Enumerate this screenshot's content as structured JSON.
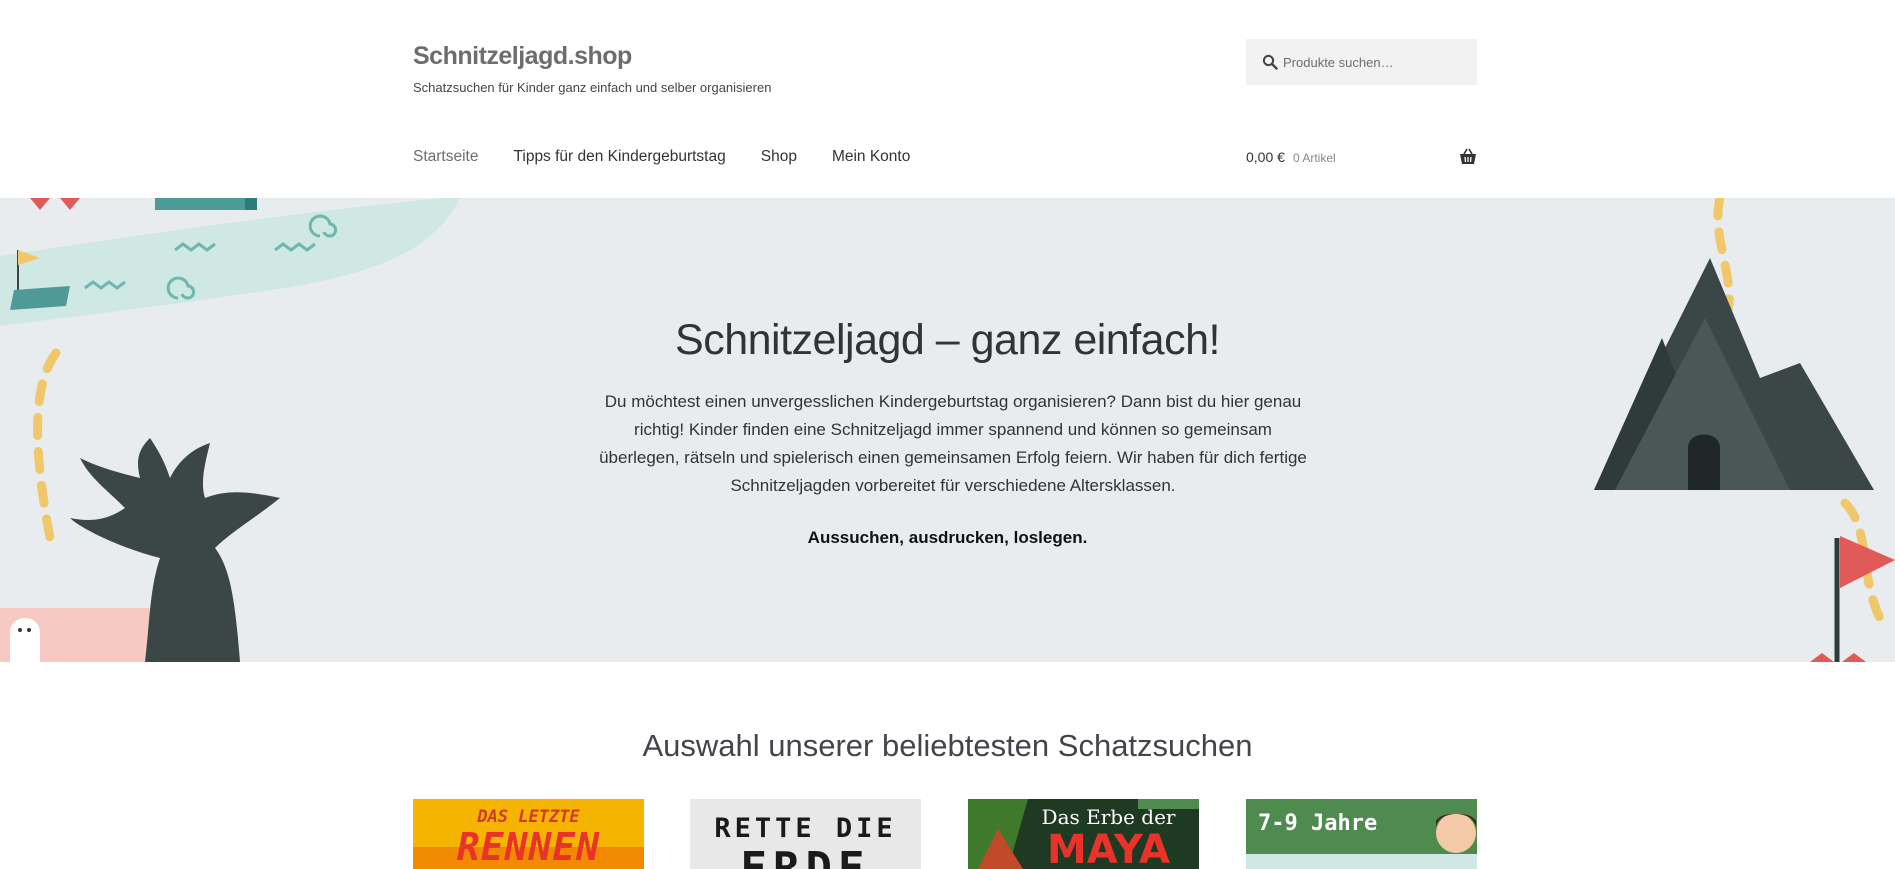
{
  "site": {
    "title": "Schnitzeljagd.shop",
    "tagline": "Schatzsuchen für Kinder ganz einfach und selber organisieren"
  },
  "search": {
    "placeholder": "Produkte suchen…",
    "icon": "search-icon"
  },
  "nav": {
    "items": [
      {
        "label": "Startseite",
        "current": true
      },
      {
        "label": "Tipps für den Kindergeburtstag"
      },
      {
        "label": "Shop"
      },
      {
        "label": "Mein Konto"
      }
    ]
  },
  "cart": {
    "amount": "0,00 €",
    "count": "0 Artikel",
    "icon": "basket-icon"
  },
  "hero": {
    "title": "Schnitzeljagd – ganz einfach!",
    "text": "Du möchtest einen unvergesslichen Kindergeburtstag organisieren? Dann bist du hier genau richtig! Kinder finden eine Schnitzeljagd immer spannend und können so gemeinsam überlegen, rätseln und spielerisch einen gemeinsamen Erfolg feiern. Wir haben für dich fertige Schnitzeljagden vorbereitet für verschiedene Altersklassen.",
    "cta": "Aussuchen, ausdrucken, loslegen."
  },
  "products_section": {
    "title": "Auswahl unserer beliebtesten Schatzsuchen",
    "products": [
      {
        "line1": "DAS LETZTE",
        "line2": "RENNEN",
        "bg": "#f5b400"
      },
      {
        "line1": "RETTE DIE",
        "line2": "ERDE",
        "bg": "#e8e8e8"
      },
      {
        "line1": "Das Erbe der",
        "line2": "MAYA",
        "bg": "#1f3a22"
      },
      {
        "line1": "7-9 Jahre",
        "line2": "",
        "bg": "#4f8a4e"
      }
    ]
  },
  "colors": {
    "hero_bg": "#e9ecef",
    "mountain": "#3b4747",
    "path": "#f0c869",
    "flag": "#e05a5a",
    "river": "#cfe8e3"
  }
}
